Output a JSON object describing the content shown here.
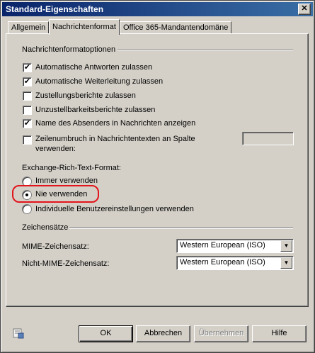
{
  "window": {
    "title": "Standard-Eigenschaften",
    "close_glyph": "✕"
  },
  "tabs": [
    {
      "label": "Allgemein"
    },
    {
      "label": "Nachrichtenformat"
    },
    {
      "label": "Office 365-Mandantendomäne"
    }
  ],
  "format_group": {
    "title": "Nachrichtenformatoptionen",
    "checkboxes": [
      {
        "label": "Automatische Antworten zulassen",
        "checked": true
      },
      {
        "label": "Automatische Weiterleitung zulassen",
        "checked": true
      },
      {
        "label": "Zustellungsberichte zulassen",
        "checked": false
      },
      {
        "label": "Unzustellbarkeitsberichte zulassen",
        "checked": false
      },
      {
        "label": "Name des Absenders in Nachrichten anzeigen",
        "checked": true
      },
      {
        "label_line1": "Zeilenumbruch in Nachrichtentexten an Spalte",
        "label_line2": "verwenden:",
        "checked": false
      }
    ],
    "line_wrap_column_value": ""
  },
  "rtf": {
    "label": "Exchange-Rich-Text-Format:",
    "options": [
      {
        "label": "Immer verwenden",
        "selected": false
      },
      {
        "label": "Nie verwenden",
        "selected": true
      },
      {
        "label": "Individuelle Benutzereinstellungen verwenden",
        "selected": false
      }
    ],
    "highlight_color": "#e3141c"
  },
  "charset_group": {
    "title": "Zeichensätze",
    "mime_label": "MIME-Zeichensatz:",
    "mime_value": "Western European (ISO)",
    "non_mime_label": "Nicht-MIME-Zeichensatz:",
    "non_mime_value": "Western European (ISO)"
  },
  "buttons": {
    "ok": "OK",
    "cancel": "Abbrechen",
    "apply": "Übernehmen",
    "help": "Hilfe"
  },
  "icons": {
    "checkmark": "✔",
    "dropdown": "▼",
    "footer": "properties-help-icon"
  },
  "colors": {
    "face": "#d4d0c8",
    "title_start": "#0a246a",
    "title_end": "#3a6ea5"
  }
}
